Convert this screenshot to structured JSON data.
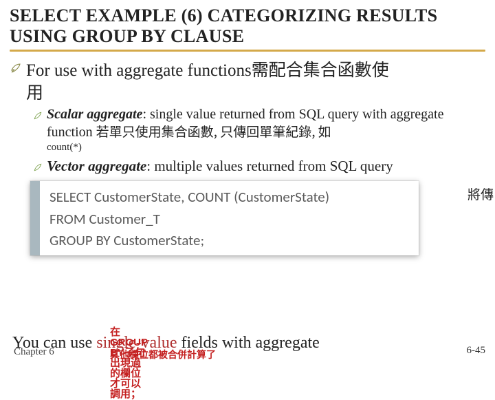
{
  "slide": {
    "title": "SELECT EXAMPLE (6) CATEGORIZING RESULTS USING GROUP BY CLAUSE",
    "main_bullet": "For use with aggregate functions",
    "main_bullet_cjk": "需配合集合函數使",
    "main_bullet_cjk2": "用",
    "scalar_label": "Scalar aggregate",
    "scalar_text": ": single value returned from SQL query with aggregate function ",
    "scalar_cjk": "若單只使用集合函數, 只傳回單筆紀錄, 如",
    "scalar_note": "count(*)",
    "vector_label": "Vector aggregate",
    "vector_text": ": multiple values returned from SQL query",
    "tail_cjk": "將傳",
    "sql": {
      "line1": "SELECT CustomerState, COUNT (CustomerState)",
      "line2": "FROM Customer_T",
      "line3": "GROUP BY CustomerState;"
    },
    "footer_red_top": "在GROUP BY子句出現過的欄位才可以調用；",
    "footer_main_a": "You can use ",
    "footer_main_b": "single-value",
    "footer_main_c": " fields with aggregate",
    "footer_red_bottom": "其他欄位都被合併計算了",
    "chapter": "Chapter 6",
    "page": "6-45"
  },
  "icons": {
    "feather": "feather-icon",
    "leaf": "leaf-icon"
  }
}
